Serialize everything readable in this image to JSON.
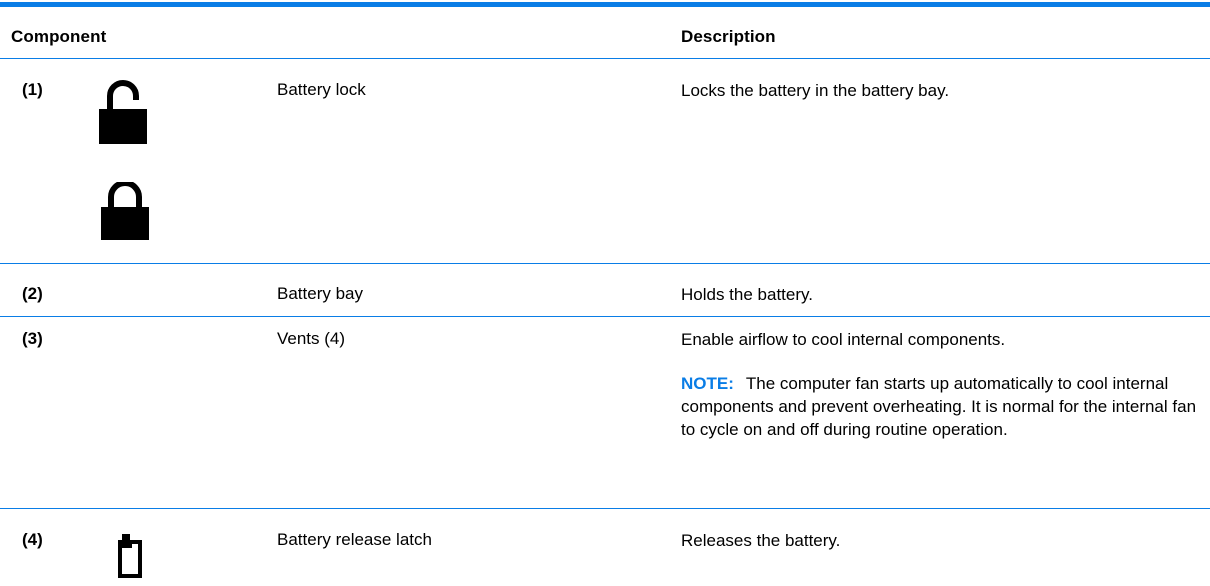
{
  "table": {
    "headers": {
      "component": "Component",
      "description": "Description"
    },
    "rows": [
      {
        "number": "(1)",
        "icons": [
          "unlocked-padlock-icon",
          "locked-padlock-icon"
        ],
        "name": "Battery lock",
        "description": "Locks the battery in the battery bay."
      },
      {
        "number": "(2)",
        "name": "Battery bay",
        "description": "Holds the battery."
      },
      {
        "number": "(3)",
        "name": "Vents (4)",
        "description": "Enable airflow to cool internal components.",
        "note_label": "NOTE:",
        "note_text": "The computer fan starts up automatically to cool internal components and prevent overheating. It is normal for the internal fan to cycle on and off during routine operation."
      },
      {
        "number": "(4)",
        "icons": [
          "battery-icon"
        ],
        "name": "Battery release latch",
        "description": "Releases the battery."
      }
    ]
  },
  "colors": {
    "rule": "#0a7de6",
    "note_label": "#0a7de6",
    "text": "#000000"
  }
}
